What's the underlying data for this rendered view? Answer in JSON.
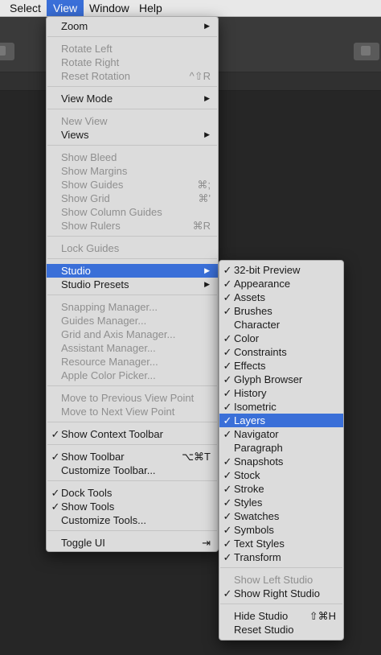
{
  "menubar": {
    "items": [
      {
        "label": "Select"
      },
      {
        "label": "View"
      },
      {
        "label": "Window"
      },
      {
        "label": "Help"
      }
    ]
  },
  "view_menu": {
    "items": [
      {
        "label": "Zoom",
        "submenu": true
      },
      {
        "separator": true
      },
      {
        "label": "Rotate Left",
        "disabled": true
      },
      {
        "label": "Rotate Right",
        "disabled": true
      },
      {
        "label": "Reset Rotation",
        "shortcut": "^⇧R",
        "disabled": true
      },
      {
        "separator": true
      },
      {
        "label": "View Mode",
        "submenu": true
      },
      {
        "separator": true
      },
      {
        "label": "New View",
        "disabled": true
      },
      {
        "label": "Views",
        "submenu": true
      },
      {
        "separator": true
      },
      {
        "label": "Show Bleed",
        "disabled": true
      },
      {
        "label": "Show Margins",
        "disabled": true
      },
      {
        "label": "Show Guides",
        "shortcut": "⌘;",
        "disabled": true
      },
      {
        "label": "Show Grid",
        "shortcut": "⌘'",
        "disabled": true
      },
      {
        "label": "Show Column Guides",
        "disabled": true
      },
      {
        "label": "Show Rulers",
        "shortcut": "⌘R",
        "disabled": true
      },
      {
        "separator": true
      },
      {
        "label": "Lock Guides",
        "disabled": true
      },
      {
        "separator": true
      },
      {
        "label": "Studio",
        "submenu": true,
        "highlighted": true
      },
      {
        "label": "Studio Presets",
        "submenu": true
      },
      {
        "separator": true
      },
      {
        "label": "Snapping Manager...",
        "disabled": true
      },
      {
        "label": "Guides Manager...",
        "disabled": true
      },
      {
        "label": "Grid and Axis Manager...",
        "disabled": true
      },
      {
        "label": "Assistant Manager...",
        "disabled": true
      },
      {
        "label": "Resource Manager...",
        "disabled": true
      },
      {
        "label": "Apple Color Picker...",
        "disabled": true
      },
      {
        "separator": true
      },
      {
        "label": "Move to Previous View Point",
        "disabled": true
      },
      {
        "label": "Move to Next View Point",
        "disabled": true
      },
      {
        "separator": true
      },
      {
        "label": "Show Context Toolbar",
        "checked": true
      },
      {
        "separator": true
      },
      {
        "label": "Show Toolbar",
        "checked": true,
        "shortcut": "⌥⌘T"
      },
      {
        "label": "Customize Toolbar..."
      },
      {
        "separator": true
      },
      {
        "label": "Dock Tools",
        "checked": true
      },
      {
        "label": "Show Tools",
        "checked": true
      },
      {
        "label": "Customize Tools..."
      },
      {
        "separator": true
      },
      {
        "label": "Toggle UI",
        "shortcut": "⇥"
      }
    ]
  },
  "studio_menu": {
    "items": [
      {
        "label": "32-bit Preview",
        "checked": true
      },
      {
        "label": "Appearance",
        "checked": true
      },
      {
        "label": "Assets",
        "checked": true
      },
      {
        "label": "Brushes",
        "checked": true
      },
      {
        "label": "Character",
        "checked": false
      },
      {
        "label": "Color",
        "checked": true
      },
      {
        "label": "Constraints",
        "checked": true
      },
      {
        "label": "Effects",
        "checked": true
      },
      {
        "label": "Glyph Browser",
        "checked": true
      },
      {
        "label": "History",
        "checked": true
      },
      {
        "label": "Isometric",
        "checked": true
      },
      {
        "label": "Layers",
        "checked": true,
        "highlighted": true
      },
      {
        "label": "Navigator",
        "checked": true
      },
      {
        "label": "Paragraph",
        "checked": false
      },
      {
        "label": "Snapshots",
        "checked": true
      },
      {
        "label": "Stock",
        "checked": true
      },
      {
        "label": "Stroke",
        "checked": true
      },
      {
        "label": "Styles",
        "checked": true
      },
      {
        "label": "Swatches",
        "checked": true
      },
      {
        "label": "Symbols",
        "checked": true
      },
      {
        "label": "Text Styles",
        "checked": true
      },
      {
        "label": "Transform",
        "checked": true
      },
      {
        "separator": true
      },
      {
        "label": "Show Left Studio",
        "disabled": true
      },
      {
        "label": "Show Right Studio",
        "checked": true
      },
      {
        "separator": true
      },
      {
        "label": "Hide Studio",
        "shortcut": "⇧⌘H"
      },
      {
        "label": "Reset Studio"
      }
    ]
  },
  "glyphs": {
    "check": "✓",
    "arrow": "▶"
  },
  "colors": {
    "highlight": "#3a6fd8",
    "menu_bg": "#dcdcdc",
    "disabled_text": "#8f8f8f",
    "app_bg": "#262626"
  },
  "icons": [
    "toolbar-button-left-icon",
    "toolbar-button-right-icon"
  ]
}
